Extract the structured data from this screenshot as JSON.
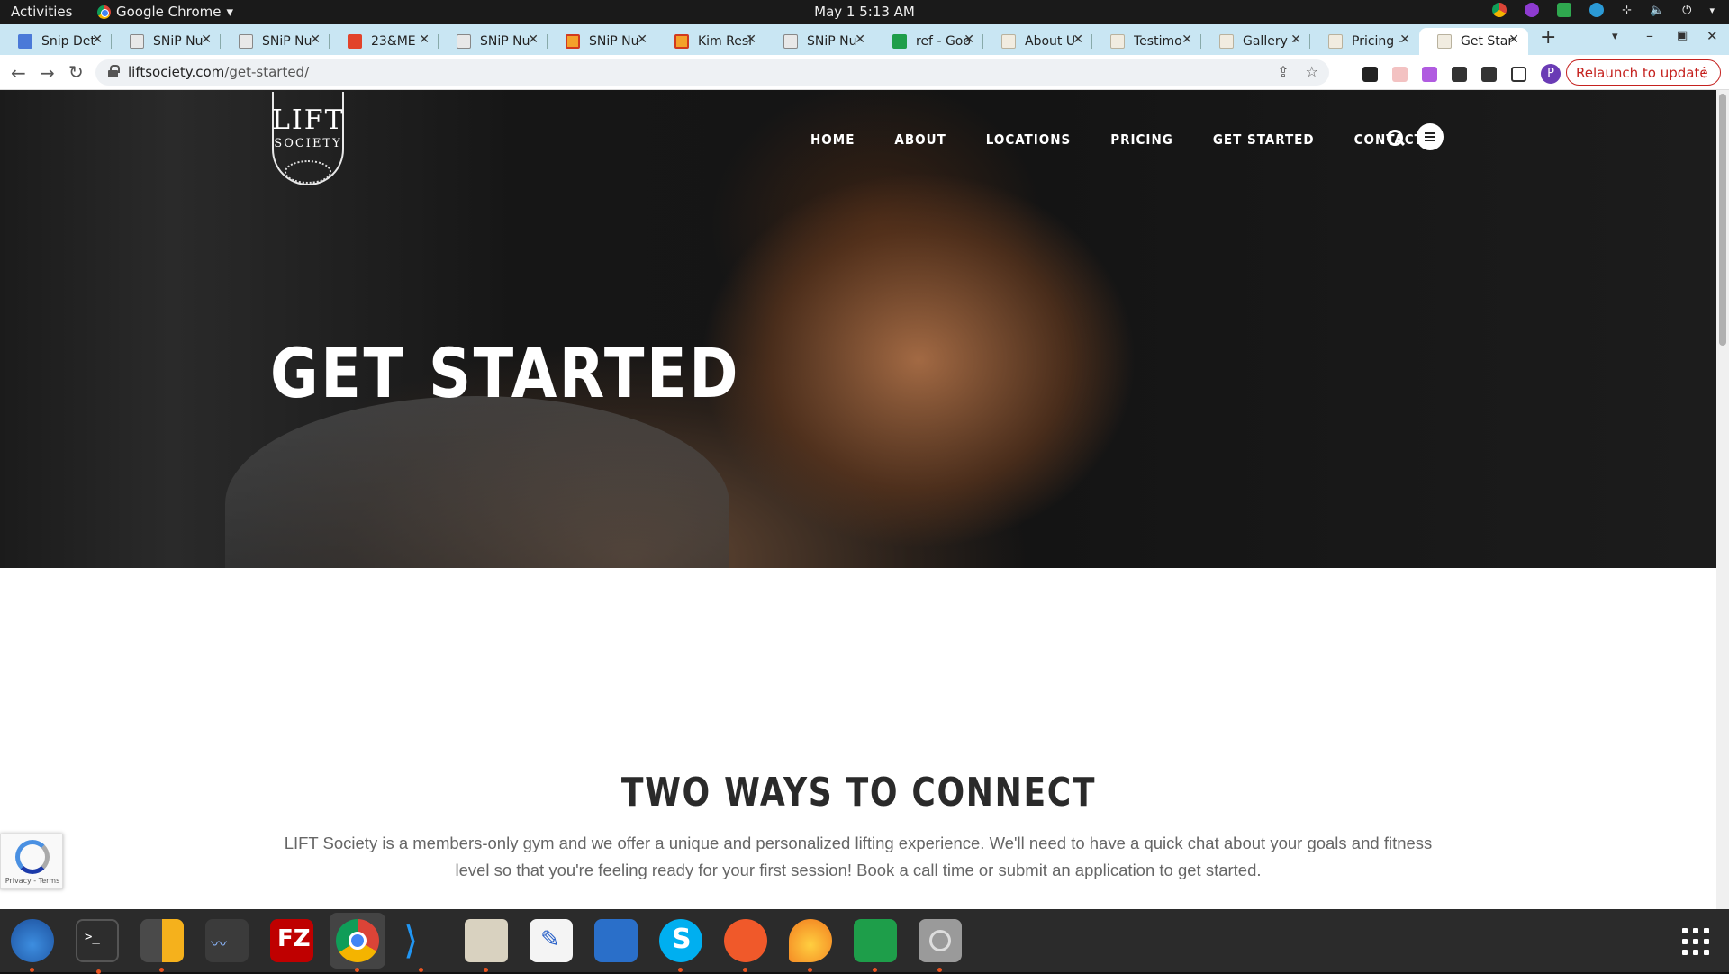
{
  "topbar": {
    "activities": "Activities",
    "app_name": "Google Chrome",
    "clock": "May 1  5:13 AM"
  },
  "tabs": [
    {
      "label": "Snip Det",
      "favicon": "doc-icon"
    },
    {
      "label": "SNiP Nu",
      "favicon": "snip-icon"
    },
    {
      "label": "SNiP Nu",
      "favicon": "snip-icon"
    },
    {
      "label": "23&ME",
      "favicon": "gitlab-icon"
    },
    {
      "label": "SNiP Nu",
      "favicon": "snip-icon"
    },
    {
      "label": "SNiP Nu",
      "favicon": "orange-icon"
    },
    {
      "label": "Kim Resi",
      "favicon": "orange-icon"
    },
    {
      "label": "SNiP Nu",
      "favicon": "snip-icon"
    },
    {
      "label": "ref - Goo",
      "favicon": "sheet-icon"
    },
    {
      "label": "About U",
      "favicon": "lift-icon"
    },
    {
      "label": "Testimo",
      "favicon": "lift-icon"
    },
    {
      "label": "Gallery -",
      "favicon": "lift-icon"
    },
    {
      "label": "Pricing -",
      "favicon": "lift-icon"
    },
    {
      "label": "Get Star",
      "favicon": "lift-icon"
    }
  ],
  "address": {
    "domain": "liftsociety.com",
    "path": "/get-started/"
  },
  "relaunch_label": "Relaunch to update",
  "profile_initial": "P",
  "site": {
    "logo_line1": "LIFT",
    "logo_line2": "SOCIETY",
    "nav": [
      "HOME",
      "ABOUT",
      "LOCATIONS",
      "PRICING",
      "GET STARTED",
      "CONTACT"
    ],
    "hero_title": "GET STARTED",
    "section_title": "TWO WAYS TO CONNECT",
    "section_body": "LIFT Society is a members-only gym and we offer a unique and personalized lifting experience. We'll need to have a quick chat about your goals and fitness level so that you're feeling ready for your first session! Book a call time or submit an application to get started.",
    "recaptcha_text": "Privacy - Terms"
  },
  "dock_apps": [
    "thunderbird-icon",
    "terminal-icon",
    "calculator-icon",
    "system-monitor-icon",
    "filezilla-icon",
    "chrome-icon",
    "vscode-icon",
    "files-icon",
    "text-editor-icon",
    "libreoffice-writer-icon",
    "skype-icon",
    "inkscape-icon",
    "blender-icon",
    "libreoffice-calc-icon",
    "disks-icon"
  ]
}
